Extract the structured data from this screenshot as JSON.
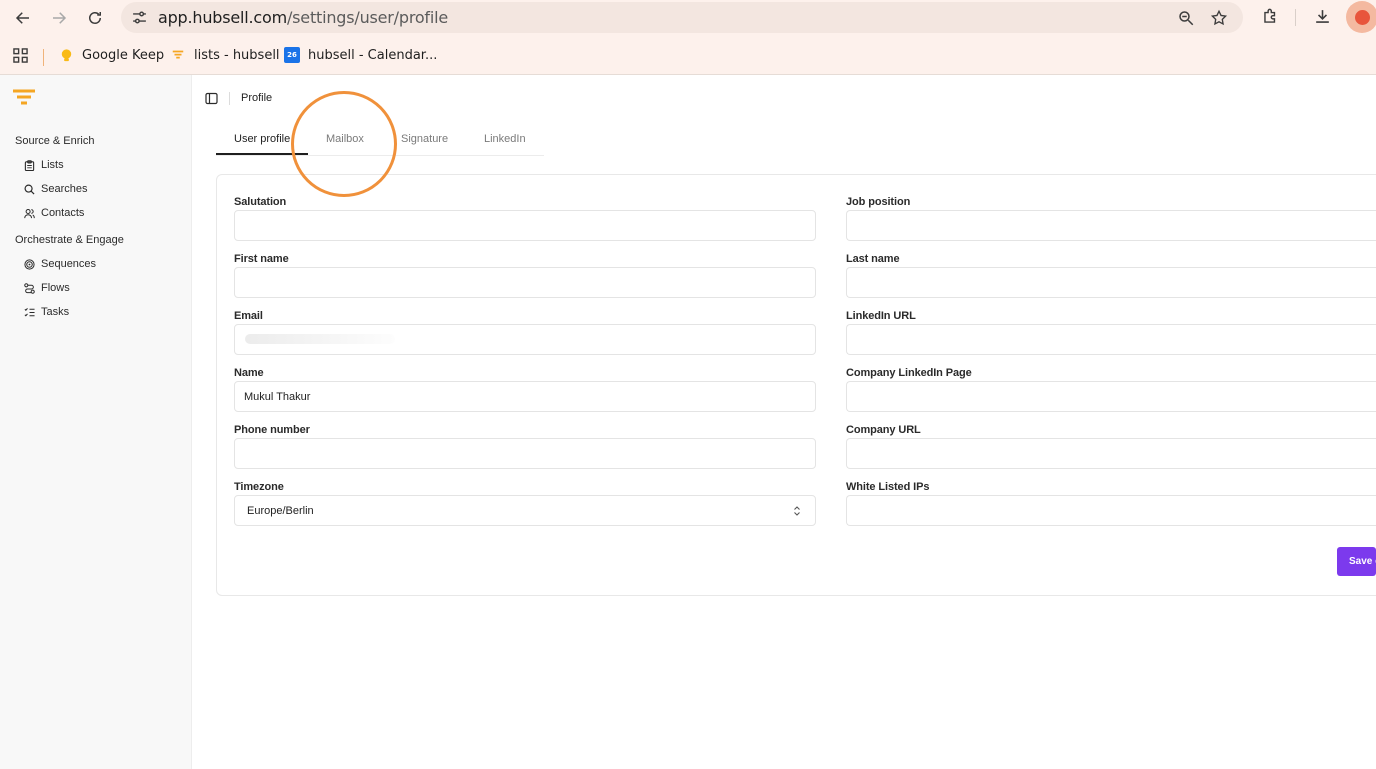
{
  "browser": {
    "url_host": "app.hubsell.com",
    "url_path": "/settings/user/profile",
    "bookmarks": [
      {
        "label": "Google Keep"
      },
      {
        "label": "lists - hubsell"
      },
      {
        "label": "hubsell - Calendar..."
      }
    ],
    "calendar_badge": "26"
  },
  "sidebar": {
    "group1_title": "Source & Enrich",
    "group1_items": [
      {
        "label": "Lists",
        "icon": "clipboard-icon"
      },
      {
        "label": "Searches",
        "icon": "search-icon"
      },
      {
        "label": "Contacts",
        "icon": "users-icon"
      }
    ],
    "group2_title": "Orchestrate & Engage",
    "group2_items": [
      {
        "label": "Sequences",
        "icon": "target-icon"
      },
      {
        "label": "Flows",
        "icon": "route-icon"
      },
      {
        "label": "Tasks",
        "icon": "list-checks-icon"
      }
    ]
  },
  "breadcrumb": "Profile",
  "tabs": [
    {
      "label": "User profile",
      "active": true
    },
    {
      "label": "Mailbox",
      "active": false
    },
    {
      "label": "Signature",
      "active": false
    },
    {
      "label": "LinkedIn",
      "active": false
    }
  ],
  "form": {
    "salutation": {
      "label": "Salutation",
      "value": ""
    },
    "first_name": {
      "label": "First name",
      "value": ""
    },
    "email": {
      "label": "Email",
      "value": ""
    },
    "name": {
      "label": "Name",
      "value": "Mukul Thakur"
    },
    "phone": {
      "label": "Phone number",
      "value": ""
    },
    "timezone": {
      "label": "Timezone",
      "value": "Europe/Berlin"
    },
    "job_position": {
      "label": "Job position",
      "value": ""
    },
    "last_name": {
      "label": "Last name",
      "value": ""
    },
    "linkedin_url": {
      "label": "LinkedIn URL",
      "value": ""
    },
    "company_linkedin": {
      "label": "Company LinkedIn Page",
      "value": ""
    },
    "company_url": {
      "label": "Company URL",
      "value": ""
    },
    "whitelisted_ips": {
      "label": "White Listed IPs",
      "value": ""
    },
    "save_label": "Save changes"
  },
  "colors": {
    "accent": "#7c3aed",
    "brand": "#f5a623",
    "highlight_ring": "#f0913b"
  }
}
